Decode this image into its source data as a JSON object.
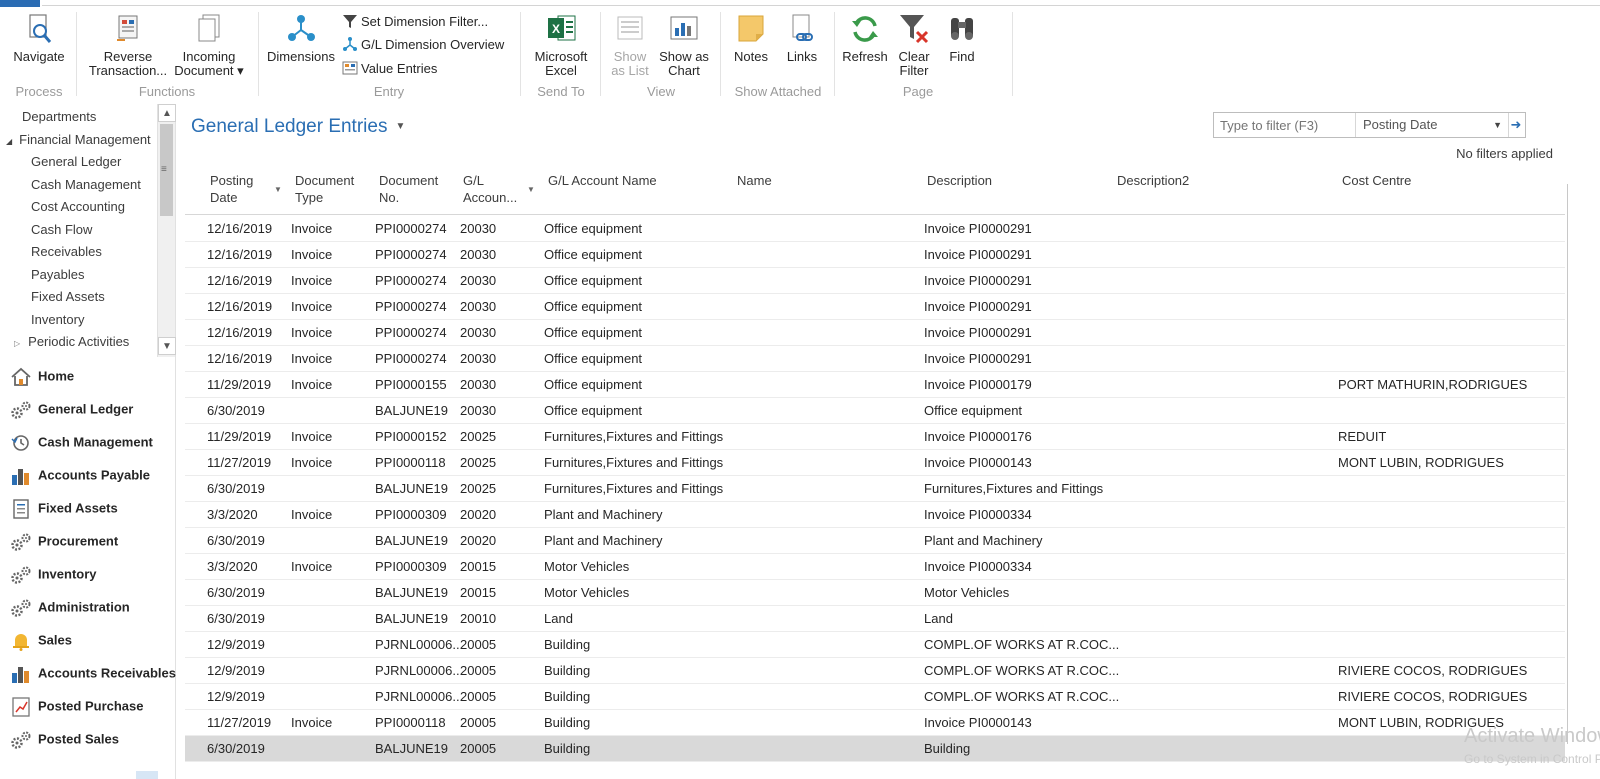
{
  "ribbon": {
    "groups": {
      "process": "Process",
      "functions": "Functions",
      "entry": "Entry",
      "send_to": "Send To",
      "view": "View",
      "show_attached": "Show Attached",
      "page": "Page"
    },
    "navigate": "Navigate",
    "reverse_1": "Reverse",
    "reverse_2": "Transaction...",
    "incoming_1": "Incoming",
    "incoming_2": "Document ▾",
    "dimensions": "Dimensions",
    "set_dim_filter": "Set Dimension Filter...",
    "gl_dim_overview": "G/L Dimension Overview",
    "value_entries": "Value Entries",
    "excel_1": "Microsoft",
    "excel_2": "Excel",
    "show_list_1": "Show",
    "show_list_2": "as List",
    "show_chart_1": "Show as",
    "show_chart_2": "Chart",
    "notes": "Notes",
    "links": "Links",
    "refresh": "Refresh",
    "clear_filter_1": "Clear",
    "clear_filter_2": "Filter",
    "find": "Find"
  },
  "navtree": {
    "items": [
      {
        "label": "Departments"
      },
      {
        "label": "Financial Management",
        "prefix": "◢"
      },
      {
        "label": "General Ledger"
      },
      {
        "label": "Cash Management"
      },
      {
        "label": "Cost Accounting"
      },
      {
        "label": "Cash Flow"
      },
      {
        "label": "Receivables"
      },
      {
        "label": "Payables"
      },
      {
        "label": "Fixed Assets"
      },
      {
        "label": "Inventory"
      },
      {
        "label": "Periodic Activities",
        "prefix": "▷"
      }
    ]
  },
  "navpane": {
    "items": [
      {
        "label": "Home",
        "icon": "home-icon"
      },
      {
        "label": "General Ledger",
        "icon": "gears-icon"
      },
      {
        "label": "Cash Management",
        "icon": "clock-icon"
      },
      {
        "label": "Accounts Payable",
        "icon": "chart-bars-icon"
      },
      {
        "label": "Fixed Assets",
        "icon": "document-icon"
      },
      {
        "label": "Procurement",
        "icon": "gears-icon"
      },
      {
        "label": "Inventory",
        "icon": "gears-icon"
      },
      {
        "label": "Administration",
        "icon": "gears-icon"
      },
      {
        "label": "Sales",
        "icon": "bell-icon"
      },
      {
        "label": "Accounts Receivables",
        "icon": "chart-bars-icon"
      },
      {
        "label": "Posted Purchase",
        "icon": "trend-icon"
      },
      {
        "label": "Posted Sales",
        "icon": "gears-icon"
      }
    ]
  },
  "page": {
    "title": "General Ledger Entries",
    "filter_placeholder": "Type to filter (F3)",
    "filter_field": "Posting Date",
    "filter_status": "No filters applied"
  },
  "grid": {
    "headers": {
      "posting_date_1": "Posting",
      "posting_date_2": "Date",
      "doc_type_1": "Document",
      "doc_type_2": "Type",
      "doc_no_1": "Document",
      "doc_no_2": "No.",
      "gl_acc_1": "G/L",
      "gl_acc_2": "Accoun...",
      "gl_name": "G/L Account Name",
      "name": "Name",
      "description": "Description",
      "description2": "Description2",
      "cost_centre": "Cost Centre"
    },
    "rows": [
      {
        "date": "12/16/2019",
        "type": "Invoice",
        "doc": "PPI0000274",
        "acc": "20030",
        "accname": "Office equipment",
        "desc": "Invoice PI0000291",
        "cc": ""
      },
      {
        "date": "12/16/2019",
        "type": "Invoice",
        "doc": "PPI0000274",
        "acc": "20030",
        "accname": "Office equipment",
        "desc": "Invoice PI0000291",
        "cc": ""
      },
      {
        "date": "12/16/2019",
        "type": "Invoice",
        "doc": "PPI0000274",
        "acc": "20030",
        "accname": "Office equipment",
        "desc": "Invoice PI0000291",
        "cc": ""
      },
      {
        "date": "12/16/2019",
        "type": "Invoice",
        "doc": "PPI0000274",
        "acc": "20030",
        "accname": "Office equipment",
        "desc": "Invoice PI0000291",
        "cc": ""
      },
      {
        "date": "12/16/2019",
        "type": "Invoice",
        "doc": "PPI0000274",
        "acc": "20030",
        "accname": "Office equipment",
        "desc": "Invoice PI0000291",
        "cc": ""
      },
      {
        "date": "12/16/2019",
        "type": "Invoice",
        "doc": "PPI0000274",
        "acc": "20030",
        "accname": "Office equipment",
        "desc": "Invoice PI0000291",
        "cc": ""
      },
      {
        "date": "11/29/2019",
        "type": "Invoice",
        "doc": "PPI0000155",
        "acc": "20030",
        "accname": "Office equipment",
        "desc": "Invoice PI0000179",
        "cc": "PORT MATHURIN,RODRIGUES"
      },
      {
        "date": "6/30/2019",
        "type": "",
        "doc": "BALJUNE19",
        "acc": "20030",
        "accname": "Office equipment",
        "desc": "Office equipment",
        "cc": ""
      },
      {
        "date": "11/29/2019",
        "type": "Invoice",
        "doc": "PPI0000152",
        "acc": "20025",
        "accname": "Furnitures,Fixtures and Fittings",
        "desc": "Invoice PI0000176",
        "cc": "REDUIT"
      },
      {
        "date": "11/27/2019",
        "type": "Invoice",
        "doc": "PPI0000118",
        "acc": "20025",
        "accname": "Furnitures,Fixtures and Fittings",
        "desc": "Invoice PI0000143",
        "cc": "MONT LUBIN, RODRIGUES"
      },
      {
        "date": "6/30/2019",
        "type": "",
        "doc": "BALJUNE19",
        "acc": "20025",
        "accname": "Furnitures,Fixtures and Fittings",
        "desc": "Furnitures,Fixtures and Fittings",
        "cc": ""
      },
      {
        "date": "3/3/2020",
        "type": "Invoice",
        "doc": "PPI0000309",
        "acc": "20020",
        "accname": "Plant and Machinery",
        "desc": "Invoice PI0000334",
        "cc": ""
      },
      {
        "date": "6/30/2019",
        "type": "",
        "doc": "BALJUNE19",
        "acc": "20020",
        "accname": "Plant and Machinery",
        "desc": "Plant and Machinery",
        "cc": ""
      },
      {
        "date": "3/3/2020",
        "type": "Invoice",
        "doc": "PPI0000309",
        "acc": "20015",
        "accname": "Motor Vehicles",
        "desc": "Invoice PI0000334",
        "cc": ""
      },
      {
        "date": "6/30/2019",
        "type": "",
        "doc": "BALJUNE19",
        "acc": "20015",
        "accname": "Motor Vehicles",
        "desc": "Motor Vehicles",
        "cc": ""
      },
      {
        "date": "6/30/2019",
        "type": "",
        "doc": "BALJUNE19",
        "acc": "20010",
        "accname": "Land",
        "desc": "Land",
        "cc": ""
      },
      {
        "date": "12/9/2019",
        "type": "",
        "doc": "PJRNL00006...",
        "acc": "20005",
        "accname": "Building",
        "desc": "COMPL.OF WORKS AT R.COC...",
        "cc": ""
      },
      {
        "date": "12/9/2019",
        "type": "",
        "doc": "PJRNL00006...",
        "acc": "20005",
        "accname": "Building",
        "desc": "COMPL.OF WORKS AT R.COC...",
        "cc": "RIVIERE COCOS, RODRIGUES"
      },
      {
        "date": "12/9/2019",
        "type": "",
        "doc": "PJRNL00006...",
        "acc": "20005",
        "accname": "Building",
        "desc": "COMPL.OF WORKS AT R.COC...",
        "cc": "RIVIERE COCOS, RODRIGUES"
      },
      {
        "date": "11/27/2019",
        "type": "Invoice",
        "doc": "PPI0000118",
        "acc": "20005",
        "accname": "Building",
        "desc": "Invoice PI0000143",
        "cc": "MONT LUBIN, RODRIGUES"
      },
      {
        "date": "6/30/2019",
        "type": "",
        "doc": "BALJUNE19",
        "acc": "20005",
        "accname": "Building",
        "desc": "Building",
        "cc": ""
      }
    ]
  },
  "watermark": {
    "line1": "Activate Windows",
    "line2": "Go to System in Control Panel to activate Windows."
  },
  "colors": {
    "accent": "#2a6eb3",
    "selected_row": "#d9d9d9"
  }
}
